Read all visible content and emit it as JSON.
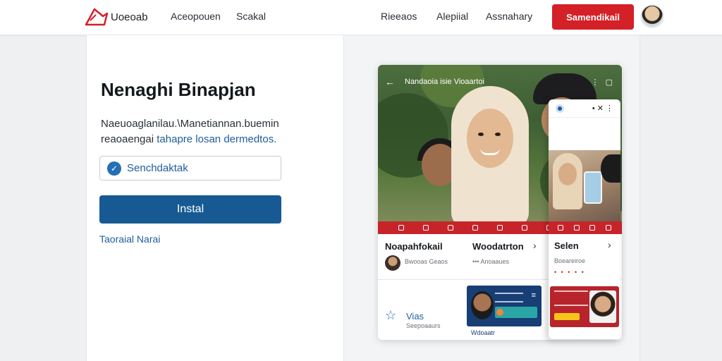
{
  "nav": {
    "brand": "Uoeoab",
    "links_left": [
      "Aceopouen",
      "Scakal"
    ],
    "links_right": [
      "Rieeaos",
      "Alepiial",
      "Assnahary"
    ],
    "signup_label": "Samendikail"
  },
  "hero": {
    "title": "Nenaghi Binapjan",
    "description_line1": "Naeuoaglanilau.\\Manetiannan.buemin",
    "description_line2_plain": "reaoaengai",
    "description_line2_link": "tahapre losan dermedtos.",
    "search_value": "Senchdaktak",
    "install_label": "Instal",
    "footer_link": "Taoraial Narai"
  },
  "preview": {
    "photo_title": "Nandaoia isie Vioaartoi",
    "cards": [
      {
        "title": "Noapahfokail",
        "subtitle": "Bwooas Geaos"
      },
      {
        "title": "Woodatrton",
        "subtitle": "•••  Anoaaues"
      }
    ],
    "bottom_title": "Vias",
    "bottom_subtitle": "Seepoaaurs",
    "blue_card_label": "Wdoaatr",
    "overlay": {
      "title": "Selen",
      "subtitle": "Boeareiroe",
      "dots": "• • • • •"
    }
  },
  "colors": {
    "accent_red": "#d42027",
    "primary_blue": "#175a93",
    "link_blue": "#1f5e9c"
  }
}
